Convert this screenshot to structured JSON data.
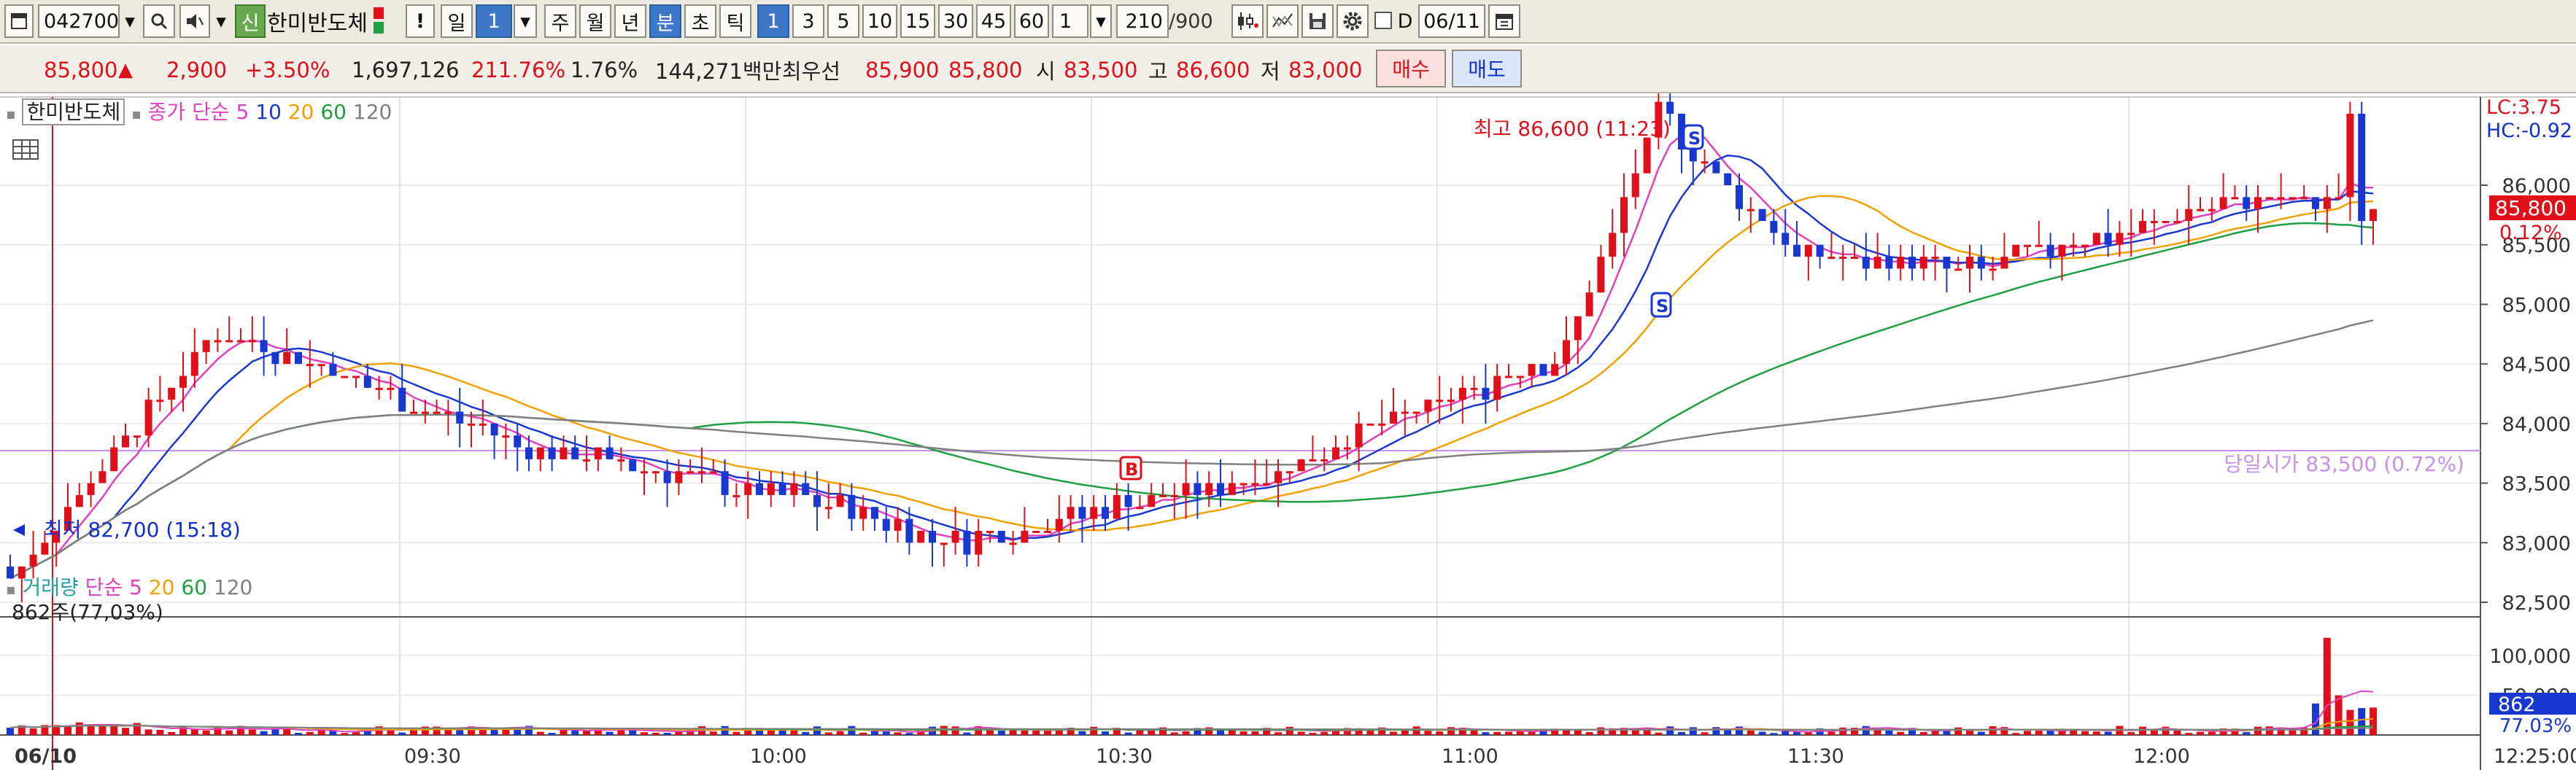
{
  "toolbar": {
    "code": "042700",
    "credit_badge": "신",
    "stock_name": "한미반도체",
    "alert": "!",
    "period_day": "일",
    "period_num": "1",
    "periods": [
      "주",
      "월",
      "년",
      "분",
      "초",
      "틱"
    ],
    "selected_period": "분",
    "minutes": [
      "1",
      "3",
      "5",
      "10",
      "15",
      "30",
      "45",
      "60"
    ],
    "selected_minute": "1",
    "interval": "1",
    "count": "210",
    "count_total": "/900",
    "date_check": "D",
    "date": "06/11"
  },
  "price": {
    "current": "85,800",
    "change_arrow": "▲",
    "change": "2,900",
    "change_pct": "+3.50%",
    "volume": "1,697,126",
    "volume_ratio": "211.76%",
    "turnover": "1.76%",
    "amount": "144,271백만",
    "best_label": "최우선",
    "best_ask": "85,900",
    "best_bid": "85,800",
    "open_label": "시",
    "open": "83,500",
    "high_label": "고",
    "high": "86,600",
    "low_label": "저",
    "low": "83,000",
    "buy": "매수",
    "sell": "매도"
  },
  "legend": {
    "name": "한미반도체",
    "ma_label": "종가 단순",
    "ma5": "5",
    "ma10": "10",
    "ma20": "20",
    "ma60": "60",
    "ma120": "120",
    "vol_label": "거래량",
    "vol_ma_label": "단순",
    "vol5": "5",
    "vol20": "20",
    "vol60": "60",
    "vol120": "120",
    "vol_current": "862주(77,03%)"
  },
  "annotations": {
    "high_text": "최고 86,600 (11:23)",
    "low_text": "최저 82,700 (15:18)",
    "open_line_text": "당일시가 83,500 (0.72%)",
    "lc": "LC:3.75",
    "hc": "HC:-0.92",
    "price_tag": "85,800",
    "price_tag_pct": "0.12%",
    "vol_tag": "862",
    "vol_tag_pct": "77.03%",
    "marker_s": "S",
    "marker_b": "B"
  },
  "colors": {
    "up": "#e0101a",
    "down": "#1838d0",
    "ma5": "#e040c0",
    "ma10": "#1838d0",
    "ma20": "#f0a000",
    "ma60": "#20a040",
    "ma120": "#808080",
    "open_line": "#c080e0"
  },
  "chart_data": [
    {
      "type": "candlestick",
      "title": "한미반도체",
      "y_ticks": [
        "86,000",
        "85,500",
        "85,000",
        "84,500",
        "84,000",
        "83,500",
        "83,000",
        "82,500"
      ],
      "x_ticks": [
        "06/10",
        "09:30",
        "10:00",
        "10:30",
        "11:00",
        "11:30",
        "12:00",
        "12:25:00"
      ],
      "ylim": [
        82300,
        86900
      ],
      "key_points": [
        {
          "t": "09:00",
          "price": 82700
        },
        {
          "t": "09:18",
          "price": 84800
        },
        {
          "t": "09:45",
          "price": 83800
        },
        {
          "t": "10:08",
          "price": 83400
        },
        {
          "t": "10:22",
          "price": 83000
        },
        {
          "t": "10:50",
          "price": 83600
        },
        {
          "t": "11:15",
          "price": 84600
        },
        {
          "t": "11:23",
          "price": 86600
        },
        {
          "t": "11:35",
          "price": 85400
        },
        {
          "t": "11:50",
          "price": 85300
        },
        {
          "t": "12:15",
          "price": 85900
        },
        {
          "t": "12:25",
          "price": 85800
        }
      ]
    },
    {
      "type": "bar",
      "title": "거래량",
      "y_ticks": [
        "100,000",
        "50,000"
      ],
      "ylim": [
        0,
        130000
      ]
    }
  ]
}
